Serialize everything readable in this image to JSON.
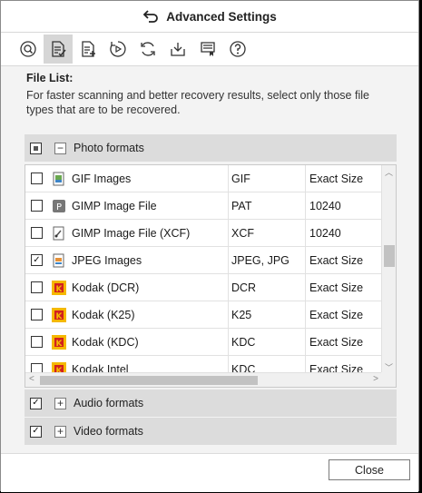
{
  "window": {
    "title": "Advanced Settings"
  },
  "toolbar": {
    "icons": [
      "search-icon",
      "file-list-icon",
      "file-add-icon",
      "preview-icon",
      "refresh-icon",
      "save-icon",
      "flag-icon",
      "help-icon"
    ],
    "active": "file-list-icon"
  },
  "section": {
    "title": "File List:",
    "description": "For faster scanning and better recovery results, select only those file types that are to be recovered."
  },
  "groups": {
    "photo": {
      "label": "Photo formats",
      "checked": "partial",
      "expanded": true
    },
    "audio": {
      "label": "Audio formats",
      "checked": "checked",
      "expanded": false
    },
    "video": {
      "label": "Video formats",
      "checked": "checked",
      "expanded": false
    }
  },
  "photo_rows": [
    {
      "name": "GIF Images",
      "ext": "GIF",
      "size": "Exact Size",
      "checked": false,
      "icon": "gif-file-icon"
    },
    {
      "name": "GIMP Image File",
      "ext": "PAT",
      "size": "10240",
      "checked": false,
      "icon": "gimp-pattern-icon"
    },
    {
      "name": "GIMP Image File (XCF)",
      "ext": "XCF",
      "size": "10240",
      "checked": false,
      "icon": "gimp-xcf-icon"
    },
    {
      "name": "JPEG Images",
      "ext": "JPEG, JPG",
      "size": "Exact Size",
      "checked": true,
      "icon": "jpeg-file-icon"
    },
    {
      "name": "Kodak (DCR)",
      "ext": "DCR",
      "size": "Exact Size",
      "checked": false,
      "icon": "kodak-icon"
    },
    {
      "name": "Kodak (K25)",
      "ext": "K25",
      "size": "Exact Size",
      "checked": false,
      "icon": "kodak-icon"
    },
    {
      "name": "Kodak (KDC)",
      "ext": "KDC",
      "size": "Exact Size",
      "checked": false,
      "icon": "kodak-icon"
    },
    {
      "name": "Kodak Intel",
      "ext": "KDC",
      "size": "Exact Size",
      "checked": false,
      "icon": "kodak-icon"
    }
  ],
  "footer": {
    "close_label": "Close"
  },
  "colors": {
    "accent_kodak": "#f5b800",
    "kodak_red": "#d22020",
    "group_bg": "#dcdcdc"
  }
}
